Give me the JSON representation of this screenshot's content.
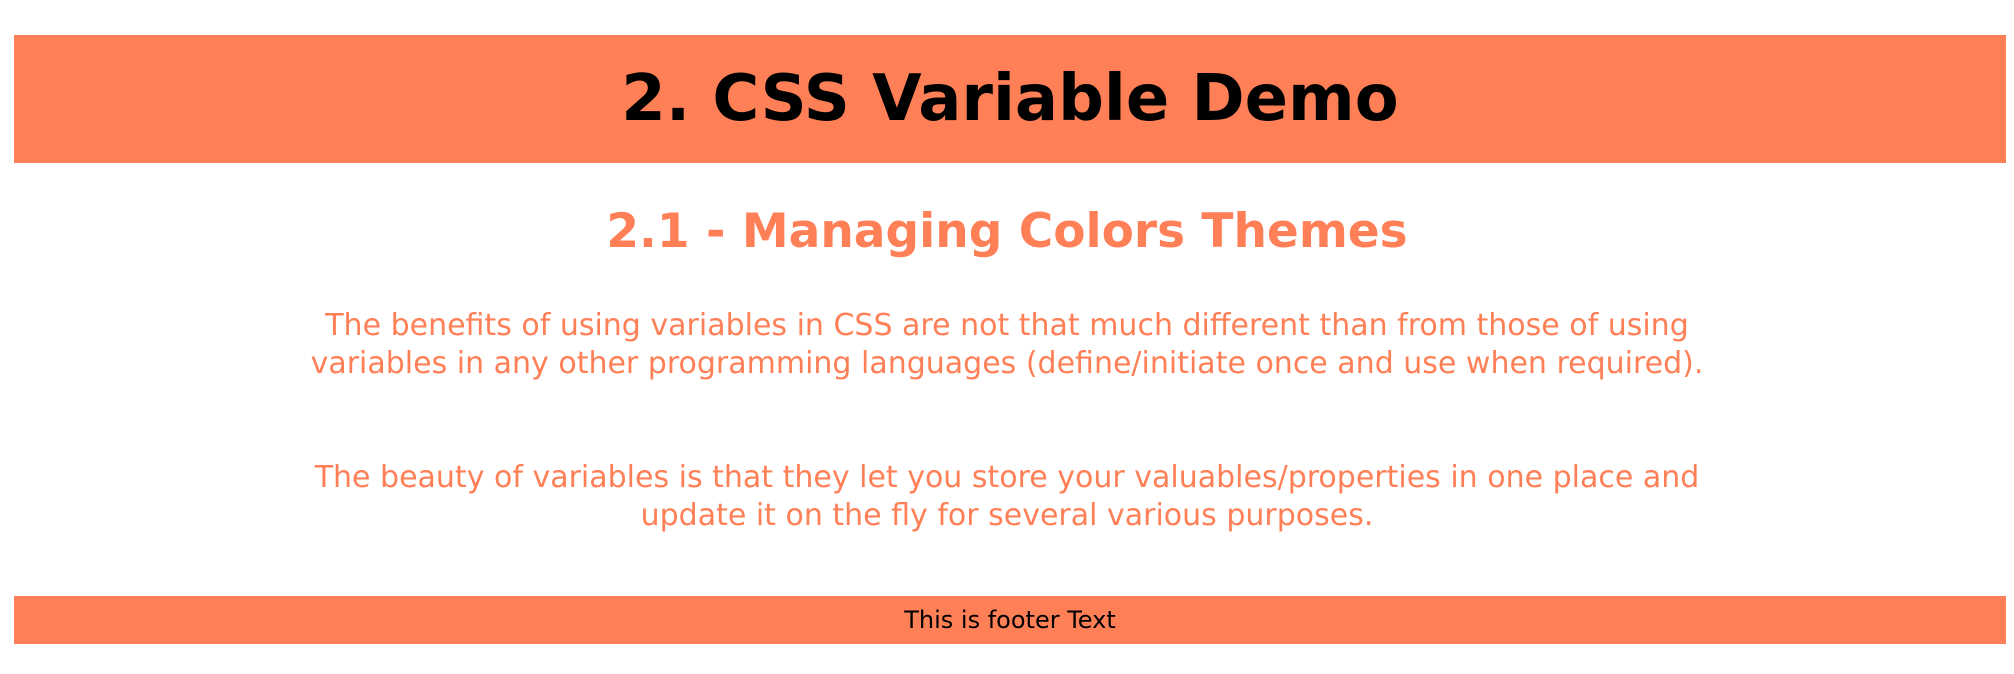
{
  "header": {
    "title": "2. CSS Variable Demo"
  },
  "main": {
    "section_title": "2.1 - Managing Colors Themes",
    "paragraphs": [
      "The benefits of using variables in CSS are not that much different than from those of using variables in any other programming languages (define/initiate once and use when required).",
      "The beauty of variables is that they let you store your valuables/properties in one place and update it on the fly for several various purposes."
    ]
  },
  "footer": {
    "text": "This is footer Text"
  },
  "colors": {
    "accent": "#ff7f57",
    "title_text": "#000000",
    "background": "#ffffff"
  }
}
